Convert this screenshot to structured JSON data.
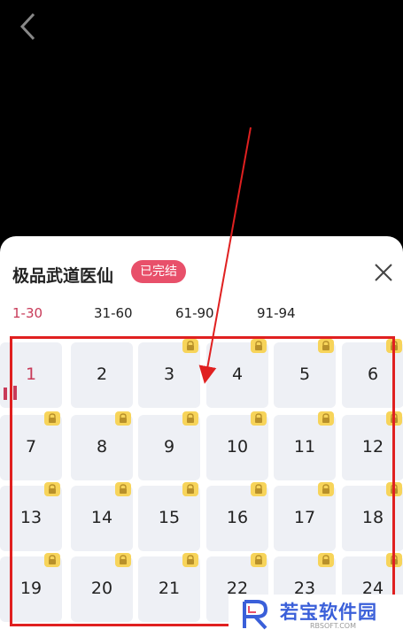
{
  "header": {
    "back_icon": "chevron-left-icon"
  },
  "sheet": {
    "title": "极品武道医仙",
    "status_badge": "已完结",
    "close_icon": "close-icon",
    "tabs": [
      {
        "label": "1-30",
        "active": true
      },
      {
        "label": "31-60",
        "active": false
      },
      {
        "label": "61-90",
        "active": false
      },
      {
        "label": "91-94",
        "active": false
      }
    ],
    "chapters": [
      {
        "num": "1",
        "locked": false,
        "current": true
      },
      {
        "num": "2",
        "locked": false,
        "current": false
      },
      {
        "num": "3",
        "locked": true,
        "current": false
      },
      {
        "num": "4",
        "locked": true,
        "current": false
      },
      {
        "num": "5",
        "locked": true,
        "current": false
      },
      {
        "num": "6",
        "locked": true,
        "current": false
      },
      {
        "num": "7",
        "locked": true,
        "current": false
      },
      {
        "num": "8",
        "locked": true,
        "current": false
      },
      {
        "num": "9",
        "locked": true,
        "current": false
      },
      {
        "num": "10",
        "locked": true,
        "current": false
      },
      {
        "num": "11",
        "locked": true,
        "current": false
      },
      {
        "num": "12",
        "locked": true,
        "current": false
      },
      {
        "num": "13",
        "locked": true,
        "current": false
      },
      {
        "num": "14",
        "locked": true,
        "current": false
      },
      {
        "num": "15",
        "locked": true,
        "current": false
      },
      {
        "num": "16",
        "locked": true,
        "current": false
      },
      {
        "num": "17",
        "locked": true,
        "current": false
      },
      {
        "num": "18",
        "locked": true,
        "current": false
      },
      {
        "num": "19",
        "locked": true,
        "current": false
      },
      {
        "num": "20",
        "locked": true,
        "current": false
      },
      {
        "num": "21",
        "locked": true,
        "current": false
      },
      {
        "num": "22",
        "locked": true,
        "current": false
      },
      {
        "num": "23",
        "locked": true,
        "current": false
      },
      {
        "num": "24",
        "locked": true,
        "current": false
      }
    ]
  },
  "watermark": {
    "text": "若宝软件园",
    "sub": "RBSOFT.COM"
  },
  "colors": {
    "accent": "#c83a58",
    "badge": "#e8506a",
    "lock": "#f7d45a",
    "annotation": "#e02020"
  }
}
